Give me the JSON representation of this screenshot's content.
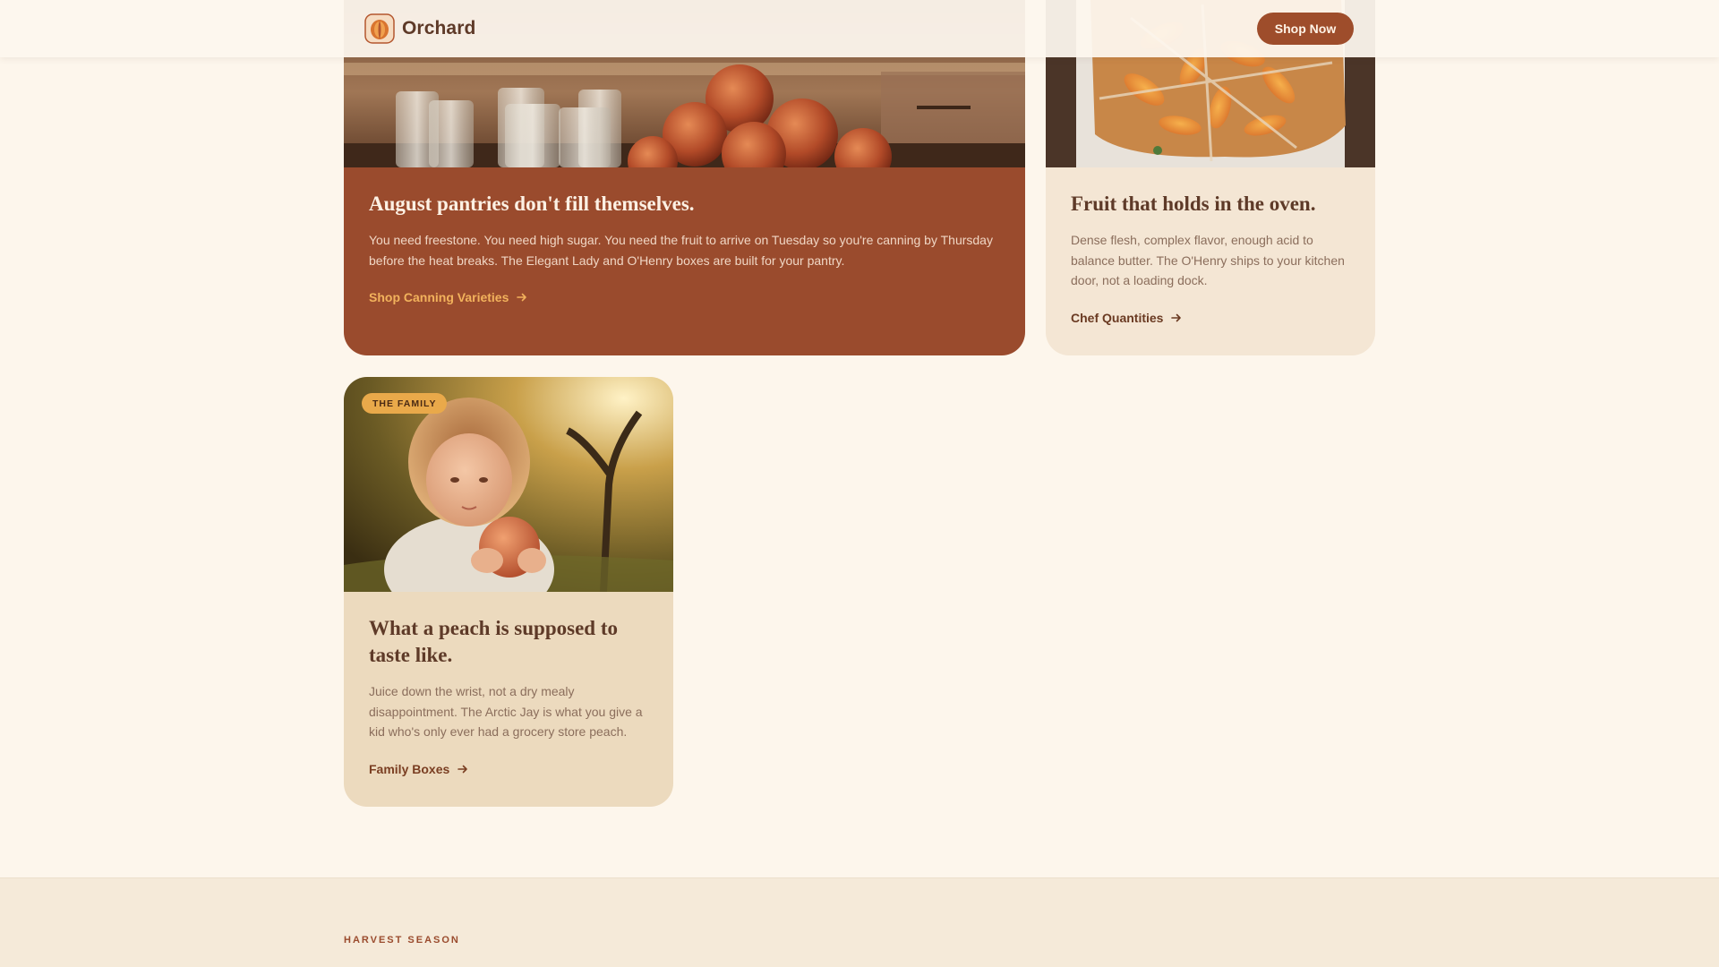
{
  "header": {
    "brand_name": "Orchard",
    "cta_label": "Shop Now"
  },
  "cards": [
    {
      "id": "canning",
      "title": "August pantries don't fill themselves.",
      "text": "You need freestone. You need high sugar. You need the fruit to arrive on Tuesday so you're canning by Thursday before the heat breaks. The Elegant Lady and O'Henry boxes are built for your pantry.",
      "link_label": "Shop Canning Varieties",
      "image": "mason-jars-and-peaches-photo"
    },
    {
      "id": "chef",
      "title": "Fruit that holds in the oven.",
      "text": "Dense flesh, complex flavor, enough acid to balance butter. The O'Henry ships to your kitchen door, not a loading dock.",
      "link_label": "Chef Quantities",
      "image": "peach-galette-photo"
    },
    {
      "id": "family",
      "tag": "THE FAMILY",
      "title": "What a peach is supposed to taste like.",
      "text": "Juice down the wrist, not a dry mealy disappointment. The Arctic Jay is what you give a kid who's only ever had a grocery store peach.",
      "link_label": "Family Boxes",
      "image": "child-holding-peach-photo"
    }
  ],
  "harvest": {
    "eyebrow": "HARVEST SEASON"
  },
  "colors": {
    "background": "#fdf6ec",
    "terracotta": "#9a4b2d",
    "cream_card": "#f4e6d4",
    "tan_card": "#ecdabe",
    "accent_gold": "#e9a94a"
  }
}
